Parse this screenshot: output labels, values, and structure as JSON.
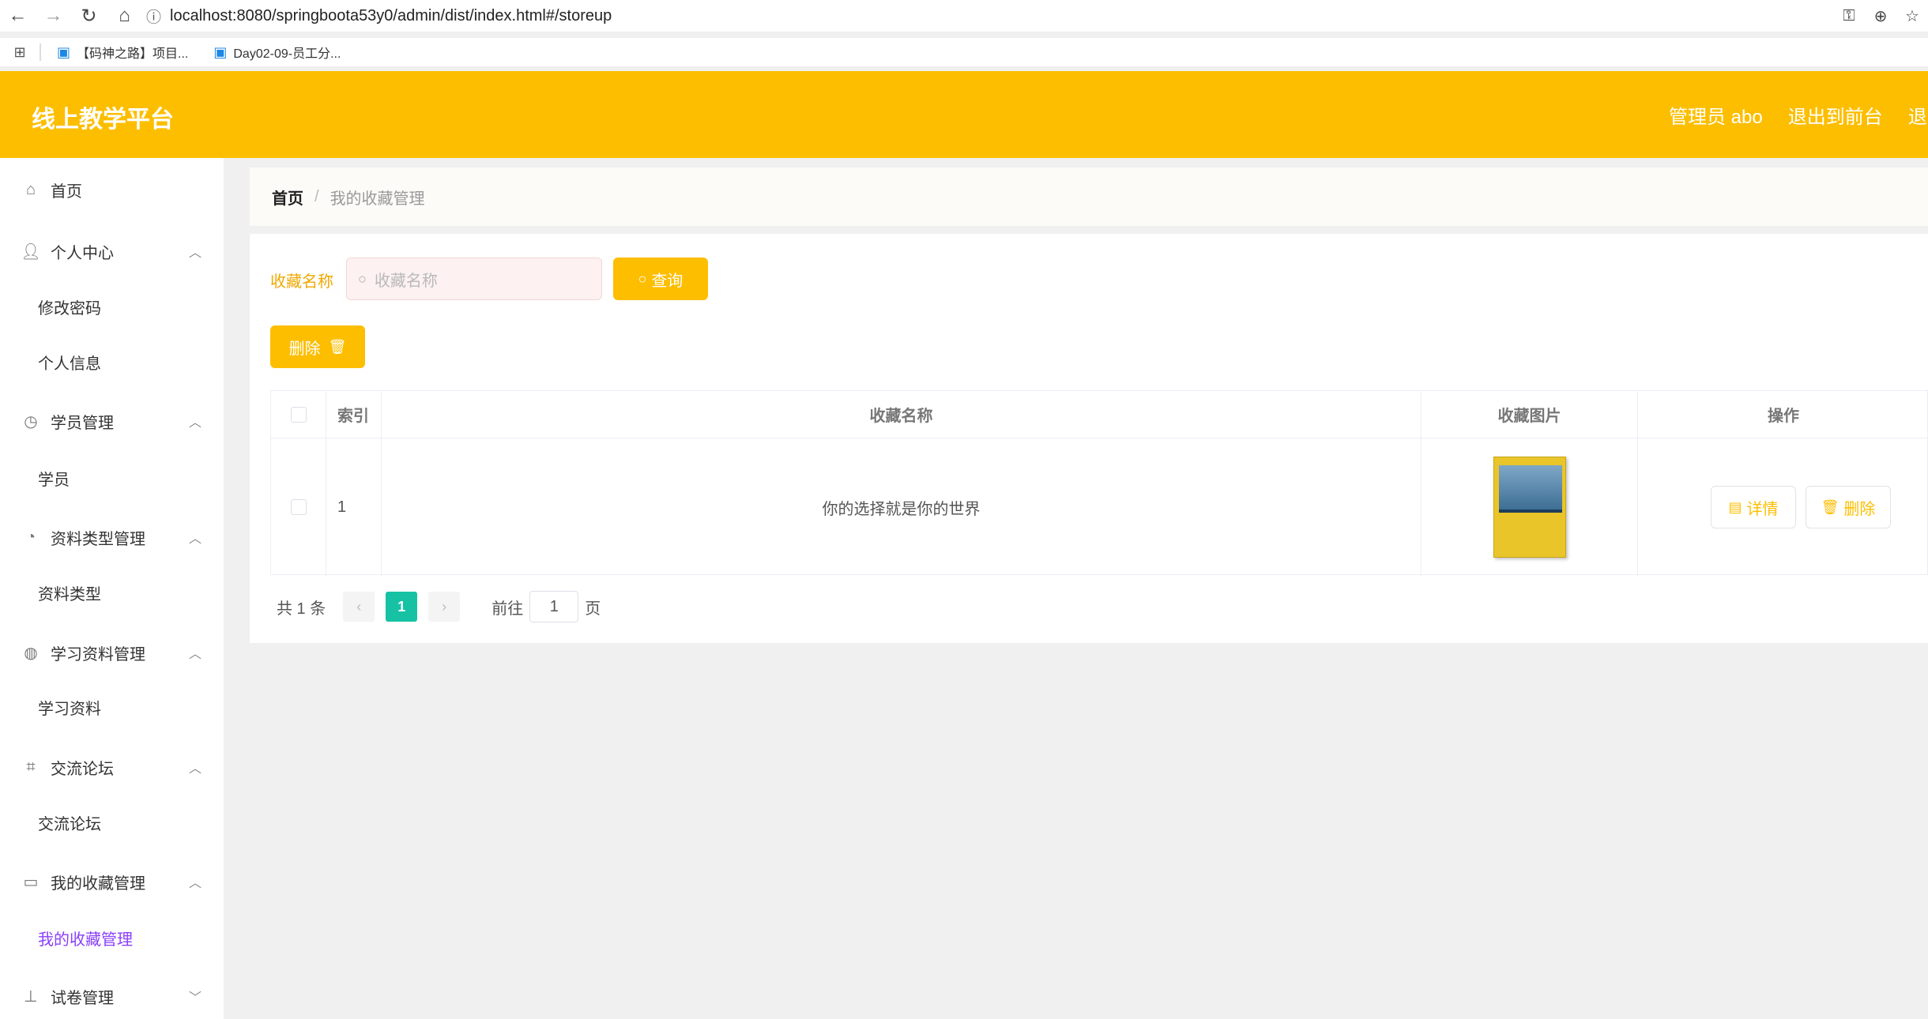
{
  "browser": {
    "url": "localhost:8080/springboota53y0/admin/dist/index.html#/storeup",
    "bookmarks": [
      "【码神之路】项目...",
      "Day02-09-员工分..."
    ]
  },
  "header": {
    "title": "线上教学平台",
    "user_label": "管理员 abo",
    "to_front_label": "退出到前台",
    "logout_label": "退出"
  },
  "sidebar": {
    "home": "首页",
    "personal_center": "个人中心",
    "change_password": "修改密码",
    "personal_info": "个人信息",
    "student_mgmt": "学员管理",
    "student": "学员",
    "material_type_mgmt": "资料类型管理",
    "material_type": "资料类型",
    "study_material_mgmt": "学习资料管理",
    "study_material": "学习资料",
    "forum": "交流论坛",
    "forum_sub": "交流论坛",
    "favorites_mgmt": "我的收藏管理",
    "favorites_sub": "我的收藏管理",
    "exam_mgmt": "试卷管理"
  },
  "breadcrumb": {
    "home": "首页",
    "separator": "/",
    "current": "我的收藏管理"
  },
  "search": {
    "label": "收藏名称",
    "placeholder": "收藏名称",
    "query_label": "查询"
  },
  "toolbar": {
    "delete_label": "删除"
  },
  "table": {
    "headers": {
      "index": "索引",
      "name": "收藏名称",
      "image": "收藏图片",
      "ops": "操作"
    },
    "rows": [
      {
        "index": "1",
        "name": "你的选择就是你的世界",
        "detail_label": "详情",
        "delete_label": "删除"
      }
    ]
  },
  "pagination": {
    "total": "共 1 条",
    "current_page": "1",
    "goto_label": "前往",
    "goto_value": "1",
    "page_suffix": "页"
  },
  "colors": {
    "accent": "#fdbe00",
    "active_menu": "#8a3ffc",
    "active_page": "#17c2a4"
  }
}
